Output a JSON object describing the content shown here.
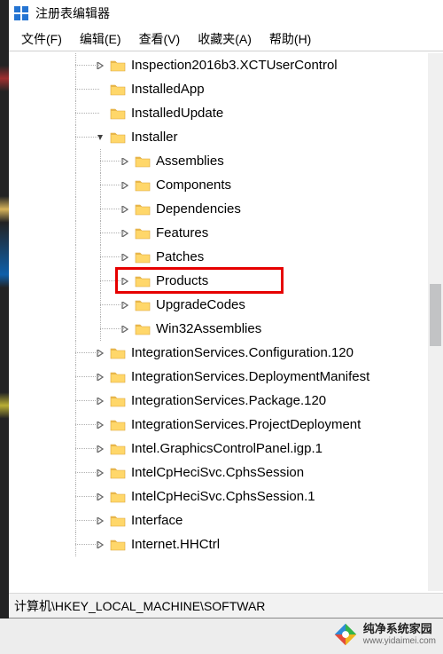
{
  "window": {
    "title": "注册表编辑器"
  },
  "menu": {
    "file": "文件(F)",
    "edit": "编辑(E)",
    "view": "查看(V)",
    "favorites": "收藏夹(A)",
    "help": "帮助(H)"
  },
  "tree": {
    "nodes": [
      {
        "indent": 3,
        "expander": "closed",
        "label": "Inspection2016b3.XCTUserControl",
        "highlighted": false
      },
      {
        "indent": 3,
        "expander": "none",
        "label": "InstalledApp",
        "highlighted": false
      },
      {
        "indent": 3,
        "expander": "none",
        "label": "InstalledUpdate",
        "highlighted": false
      },
      {
        "indent": 3,
        "expander": "open",
        "label": "Installer",
        "highlighted": false
      },
      {
        "indent": 4,
        "expander": "closed",
        "label": "Assemblies",
        "highlighted": false
      },
      {
        "indent": 4,
        "expander": "closed",
        "label": "Components",
        "highlighted": false
      },
      {
        "indent": 4,
        "expander": "closed",
        "label": "Dependencies",
        "highlighted": false
      },
      {
        "indent": 4,
        "expander": "closed",
        "label": "Features",
        "highlighted": false
      },
      {
        "indent": 4,
        "expander": "closed",
        "label": "Patches",
        "highlighted": false
      },
      {
        "indent": 4,
        "expander": "closed",
        "label": "Products",
        "highlighted": true
      },
      {
        "indent": 4,
        "expander": "closed",
        "label": "UpgradeCodes",
        "highlighted": false
      },
      {
        "indent": 4,
        "expander": "closed",
        "label": "Win32Assemblies",
        "highlighted": false
      },
      {
        "indent": 3,
        "expander": "closed",
        "label": "IntegrationServices.Configuration.120",
        "highlighted": false
      },
      {
        "indent": 3,
        "expander": "closed",
        "label": "IntegrationServices.DeploymentManifest",
        "highlighted": false
      },
      {
        "indent": 3,
        "expander": "closed",
        "label": "IntegrationServices.Package.120",
        "highlighted": false
      },
      {
        "indent": 3,
        "expander": "closed",
        "label": "IntegrationServices.ProjectDeployment",
        "highlighted": false
      },
      {
        "indent": 3,
        "expander": "closed",
        "label": "Intel.GraphicsControlPanel.igp.1",
        "highlighted": false
      },
      {
        "indent": 3,
        "expander": "closed",
        "label": "IntelCpHeciSvc.CphsSession",
        "highlighted": false
      },
      {
        "indent": 3,
        "expander": "closed",
        "label": "IntelCpHeciSvc.CphsSession.1",
        "highlighted": false
      },
      {
        "indent": 3,
        "expander": "closed",
        "label": "Interface",
        "highlighted": false
      },
      {
        "indent": 3,
        "expander": "closed",
        "label": "Internet.HHCtrl",
        "highlighted": false
      }
    ]
  },
  "statusbar": {
    "path": "计算机\\HKEY_LOCAL_MACHINE\\SOFTWAR"
  },
  "watermark": {
    "line1": "纯净系统家园",
    "line2": "www.yidaimei.com"
  }
}
